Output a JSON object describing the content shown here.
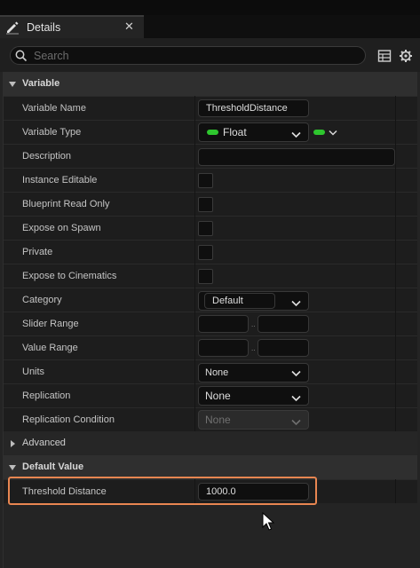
{
  "tab": {
    "title": "Details",
    "close_glyph": "✕",
    "icon": "pencil-icon"
  },
  "search": {
    "placeholder": "Search",
    "value": ""
  },
  "toolbar": {
    "icons": [
      "table-view-icon",
      "settings-gear-icon"
    ]
  },
  "colors": {
    "accent": "#e88651",
    "float_pin": "#2ec62e",
    "panel_bg": "#242424",
    "row_bg": "#1d1d1d"
  },
  "variable": {
    "header": "Variable",
    "name_label": "Variable Name",
    "name_value": "ThresholdDistance",
    "type_label": "Variable Type",
    "type_value": "Float",
    "description_label": "Description",
    "description_value": "",
    "instance_editable_label": "Instance Editable",
    "blueprint_read_only_label": "Blueprint Read Only",
    "expose_on_spawn_label": "Expose on Spawn",
    "private_label": "Private",
    "expose_to_cinematics_label": "Expose to Cinematics",
    "category_label": "Category",
    "category_value": "Default",
    "slider_range_label": "Slider Range",
    "slider_range_separator": "..",
    "value_range_label": "Value Range",
    "value_range_separator": "..",
    "units_label": "Units",
    "units_value": "None",
    "replication_label": "Replication",
    "replication_value": "None",
    "replication_condition_label": "Replication Condition",
    "replication_condition_value": "None"
  },
  "advanced": {
    "header": "Advanced"
  },
  "default_value": {
    "header": "Default Value",
    "threshold_label": "Threshold Distance",
    "threshold_value": "1000.0"
  }
}
